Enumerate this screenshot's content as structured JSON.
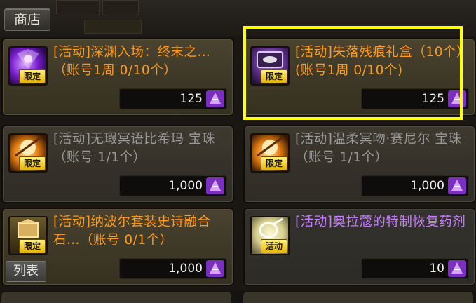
{
  "shop_tab": "商店",
  "list_button": "列表",
  "colors": {
    "orange": "#ff9a1a",
    "gray": "#9a9a9a",
    "purple": "#c77dff",
    "highlight": "#ffff00"
  },
  "items": [
    {
      "title": "[活动]深渊入场：终末之…（账号1周 0/10个）",
      "price": "125",
      "tag": "限定",
      "icon": "abyss-ticket-icon",
      "color": "#ff9a1a"
    },
    {
      "title": "[活动]失落残痕礼盒（10个）(账号1周 0/10个)",
      "price": "125",
      "tag": "限定",
      "icon": "lost-trace-giftbox-icon",
      "color": "#ff9a1a"
    },
    {
      "title": "[活动]无瑕冥语比希玛 宝珠 （账号 1/1个）",
      "price": "1,000",
      "tag": "限定",
      "icon": "orb-icon",
      "color": "#9a9a9a"
    },
    {
      "title": "[活动]温柔冥吻·赛尼尔 宝珠 （账号 1/1个）",
      "price": "1,000",
      "tag": "限定",
      "icon": "orb-icon",
      "color": "#9a9a9a"
    },
    {
      "title": "[活动]纳波尔套装史诗融合石…（账号 0/1个）",
      "price": "1,000",
      "tag": "限定",
      "icon": "fusion-stone-icon",
      "color": "#ff9a1a"
    },
    {
      "title": "[活动]奥拉蔻的特制恢复药剂",
      "price": "10",
      "tag": "活动",
      "icon": "potion-icon",
      "color": "#c77dff"
    }
  ]
}
